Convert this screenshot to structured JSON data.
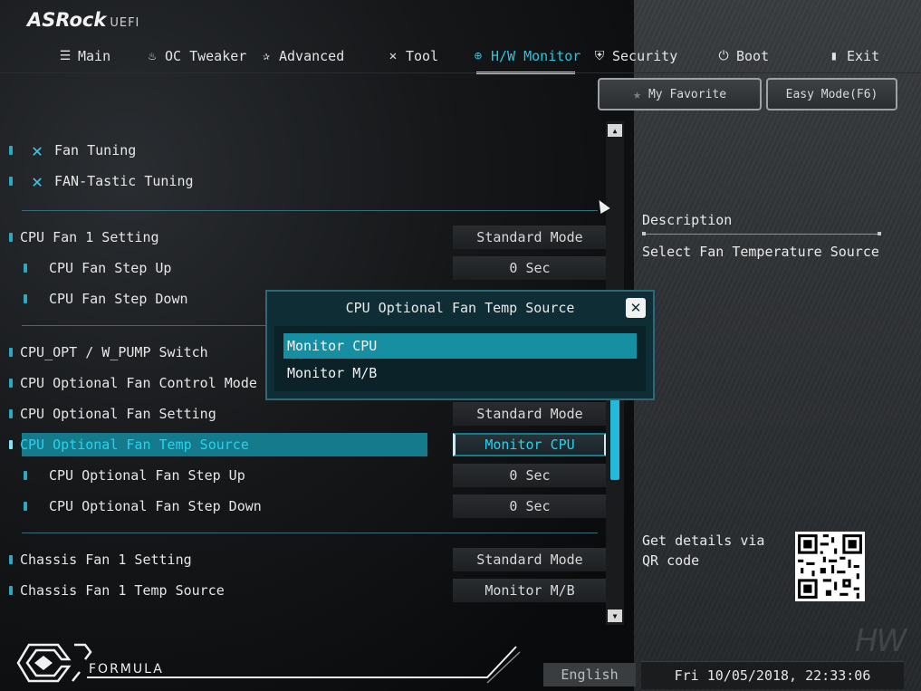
{
  "brand": {
    "name": "ASRock",
    "suffix": "UEFI"
  },
  "nav": {
    "tabs": [
      {
        "label": "Main",
        "icon": "list-icon"
      },
      {
        "label": "OC Tweaker",
        "icon": "flame-icon"
      },
      {
        "label": "Advanced",
        "icon": "star-icon"
      },
      {
        "label": "Tool",
        "icon": "tools-icon"
      },
      {
        "label": "H/W Monitor",
        "icon": "monitor-icon",
        "active": true
      },
      {
        "label": "Security",
        "icon": "shield-icon"
      },
      {
        "label": "Boot",
        "icon": "power-icon"
      },
      {
        "label": "Exit",
        "icon": "exit-door-icon"
      }
    ]
  },
  "buttons": {
    "favorite": "My Favorite",
    "easy_mode": "Easy Mode(F6)"
  },
  "tools": [
    {
      "label": "Fan Tuning"
    },
    {
      "label": "FAN-Tastic Tuning"
    }
  ],
  "settings": [
    {
      "label": "CPU Fan 1 Setting",
      "value": "Standard Mode"
    },
    {
      "label": "CPU Fan Step Up",
      "value": "0 Sec"
    },
    {
      "label": "CPU Fan Step Down",
      "value": ""
    },
    {
      "label": "CPU_OPT / W_PUMP Switch",
      "value": ""
    },
    {
      "label": "CPU Optional Fan Control Mode",
      "value": ""
    },
    {
      "label": "CPU Optional Fan Setting",
      "value": "Standard Mode"
    },
    {
      "label": "CPU Optional Fan Temp Source",
      "value": "Monitor CPU",
      "selected": true
    },
    {
      "label": "CPU Optional Fan Step Up",
      "value": "0 Sec"
    },
    {
      "label": "CPU Optional Fan Step Down",
      "value": "0 Sec"
    },
    {
      "label": "Chassis Fan 1 Setting",
      "value": "Standard Mode"
    },
    {
      "label": "Chassis Fan 1 Temp Source",
      "value": "Monitor M/B"
    }
  ],
  "description": {
    "title": "Description",
    "text": "Select Fan Temperature Source"
  },
  "qr": {
    "text": "Get details via QR code"
  },
  "modal": {
    "title": "CPU Optional Fan Temp Source",
    "options": [
      {
        "label": "Monitor CPU",
        "selected": true
      },
      {
        "label": "Monitor M/B"
      }
    ]
  },
  "footer": {
    "logo_text": "FORMULA",
    "language": "English",
    "datetime": "Fri 10/05/2018, 22:33:06",
    "watermark": "HW"
  },
  "colors": {
    "accent": "#23c9e6",
    "selection": "#157a8c",
    "modal_bg": "#0f2d35"
  }
}
